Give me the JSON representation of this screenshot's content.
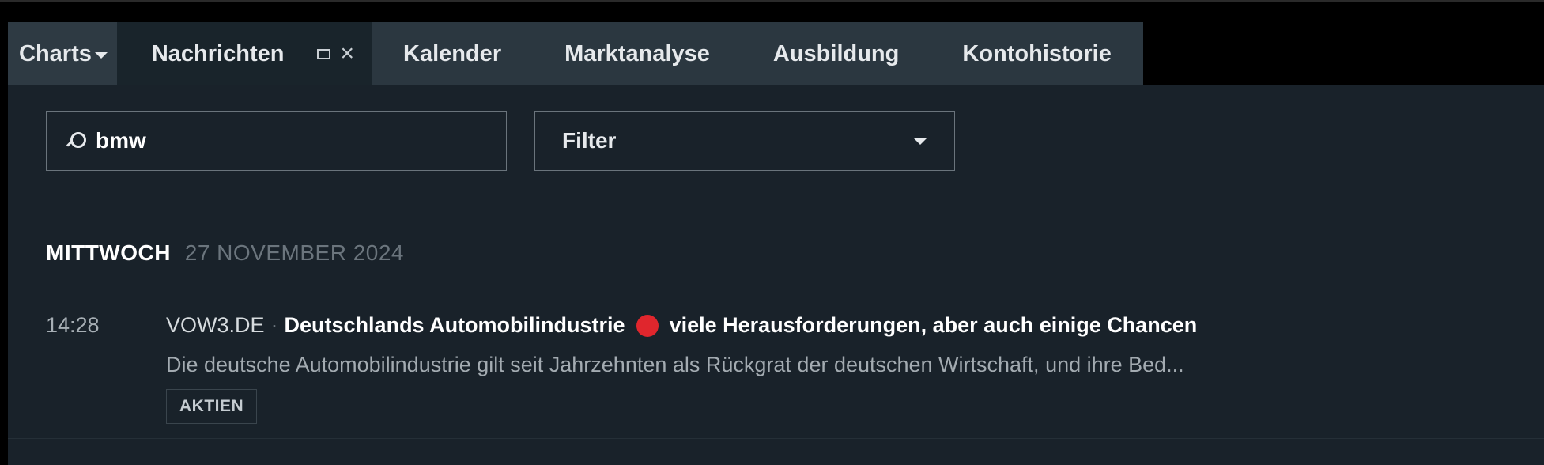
{
  "tabs": {
    "charts_label": "Charts",
    "items": [
      {
        "label": "Nachrichten",
        "active": true
      },
      {
        "label": "Kalender"
      },
      {
        "label": "Marktanalyse"
      },
      {
        "label": "Ausbildung"
      },
      {
        "label": "Kontohistorie"
      }
    ],
    "icons": {
      "maximize": "maximize-icon",
      "close": "close-icon"
    },
    "close_glyph": "×"
  },
  "search": {
    "value": "bmw",
    "placeholder": "",
    "icon": "search-icon"
  },
  "filter": {
    "selected": "Filter",
    "icon": "chevron-down-icon"
  },
  "news": {
    "date_group": {
      "weekday": "MITTWOCH",
      "date": "27 NOVEMBER 2024"
    },
    "items": [
      {
        "time": "14:28",
        "symbol": "VOW3.DE",
        "separator": "·",
        "title_part1": "Deutschlands Automobilindustrie",
        "title_part2": "viele Herausforderungen, aber auch einige Chancen",
        "summary": "Die deutsche Automobilindustrie gilt seit Jahrzehnten als Rückgrat der deutschen Wirtschaft, und ihre Bed...",
        "tag": "AKTIEN",
        "dot_color": "#e0262d"
      }
    ]
  },
  "colors": {
    "background": "#000000",
    "panel": "#19222a",
    "tab_inactive": "#2b3740",
    "accent_red": "#e0262d"
  }
}
